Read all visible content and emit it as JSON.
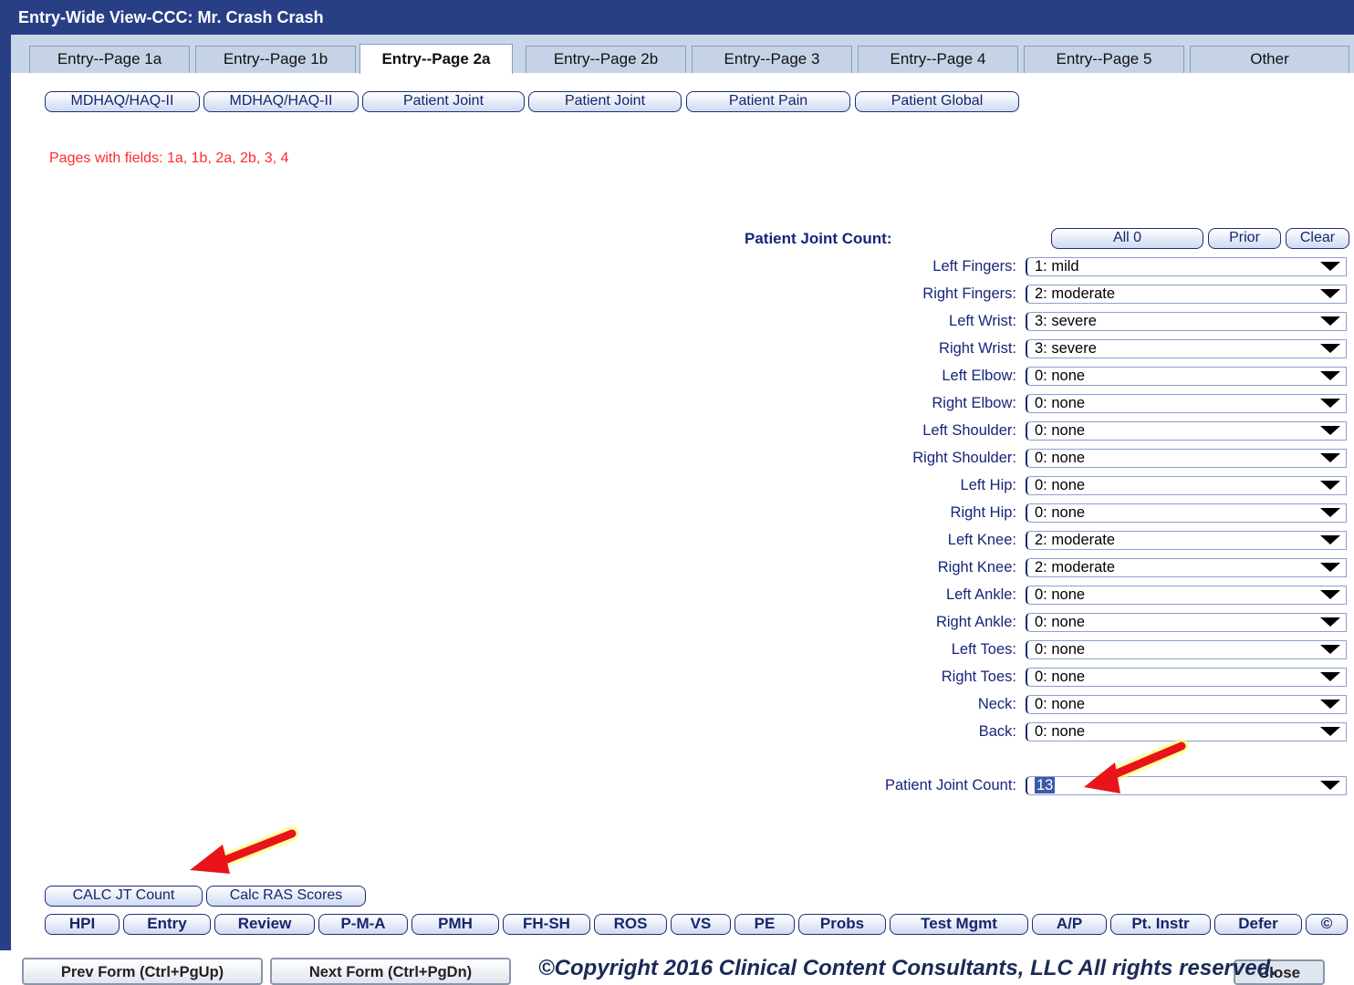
{
  "window": {
    "title": "Entry-Wide View-CCC: Mr. Crash Crash"
  },
  "tabs": [
    {
      "label": "Entry--Page 1a"
    },
    {
      "label": "Entry--Page 1b"
    },
    {
      "label": "Entry--Page 2a",
      "active": true
    },
    {
      "label": "Entry--Page 2b"
    },
    {
      "label": "Entry--Page 3"
    },
    {
      "label": "Entry--Page 4"
    },
    {
      "label": "Entry--Page 5"
    },
    {
      "label": "Other"
    }
  ],
  "form_buttons": [
    {
      "label": "MDHAQ/HAQ-II"
    },
    {
      "label": "MDHAQ/HAQ-II"
    },
    {
      "label": "Patient Joint"
    },
    {
      "label": "Patient Joint"
    },
    {
      "label": "Patient Pain"
    },
    {
      "label": "Patient Global"
    }
  ],
  "pages_note": "Pages with fields:  1a,  1b,  2a,  2b,  3,  4",
  "joint_count": {
    "header": "Patient Joint Count:",
    "buttons": {
      "all0": "All 0",
      "prior": "Prior",
      "clear": "Clear"
    },
    "rows": [
      {
        "label": "Left Fingers:",
        "value": "1: mild"
      },
      {
        "label": "Right Fingers:",
        "value": "2: moderate"
      },
      {
        "label": "Left Wrist:",
        "value": "3: severe"
      },
      {
        "label": "Right Wrist:",
        "value": "3: severe"
      },
      {
        "label": "Left Elbow:",
        "value": "0: none"
      },
      {
        "label": "Right Elbow:",
        "value": "0: none"
      },
      {
        "label": "Left Shoulder:",
        "value": "0: none"
      },
      {
        "label": "Right Shoulder:",
        "value": "0: none"
      },
      {
        "label": "Left Hip:",
        "value": "0: none"
      },
      {
        "label": "Right Hip:",
        "value": "0: none"
      },
      {
        "label": "Left Knee:",
        "value": "2: moderate"
      },
      {
        "label": "Right Knee:",
        "value": "2: moderate"
      },
      {
        "label": "Left Ankle:",
        "value": "0: none"
      },
      {
        "label": "Right Ankle:",
        "value": "0: none"
      },
      {
        "label": "Left Toes:",
        "value": "0: none"
      },
      {
        "label": "Right Toes:",
        "value": "0: none"
      },
      {
        "label": "Neck:",
        "value": "0: none"
      },
      {
        "label": "Back:",
        "value": "0: none"
      }
    ],
    "total": {
      "label": "Patient Joint Count:",
      "value": "13"
    }
  },
  "calc_buttons": {
    "calc_jt": "CALC JT Count",
    "calc_ras": "Calc RAS Scores"
  },
  "nav_buttons": [
    {
      "label": "HPI"
    },
    {
      "label": "Entry"
    },
    {
      "label": "Review"
    },
    {
      "label": "P-M-A"
    },
    {
      "label": "PMH"
    },
    {
      "label": "FH-SH"
    },
    {
      "label": "ROS"
    },
    {
      "label": "VS"
    },
    {
      "label": "PE"
    },
    {
      "label": "Probs"
    },
    {
      "label": "Test Mgmt"
    },
    {
      "label": "A/P"
    },
    {
      "label": "Pt. Instr"
    },
    {
      "label": "Defer"
    },
    {
      "label": "©"
    }
  ],
  "footer": {
    "prev": "Prev Form (Ctrl+PgUp)",
    "next": "Next Form (Ctrl+PgDn)",
    "copyright": "©Copyright 2016 Clinical Content Consultants, LLC All rights reserved.",
    "close": "Close"
  },
  "colors": {
    "titlebar": "#283f86",
    "accent_red": "#ff2a2a",
    "label_blue": "#16257a"
  },
  "icons": {
    "dropdown": "chevron-down-icon",
    "annotation": "red-arrow-icon"
  }
}
